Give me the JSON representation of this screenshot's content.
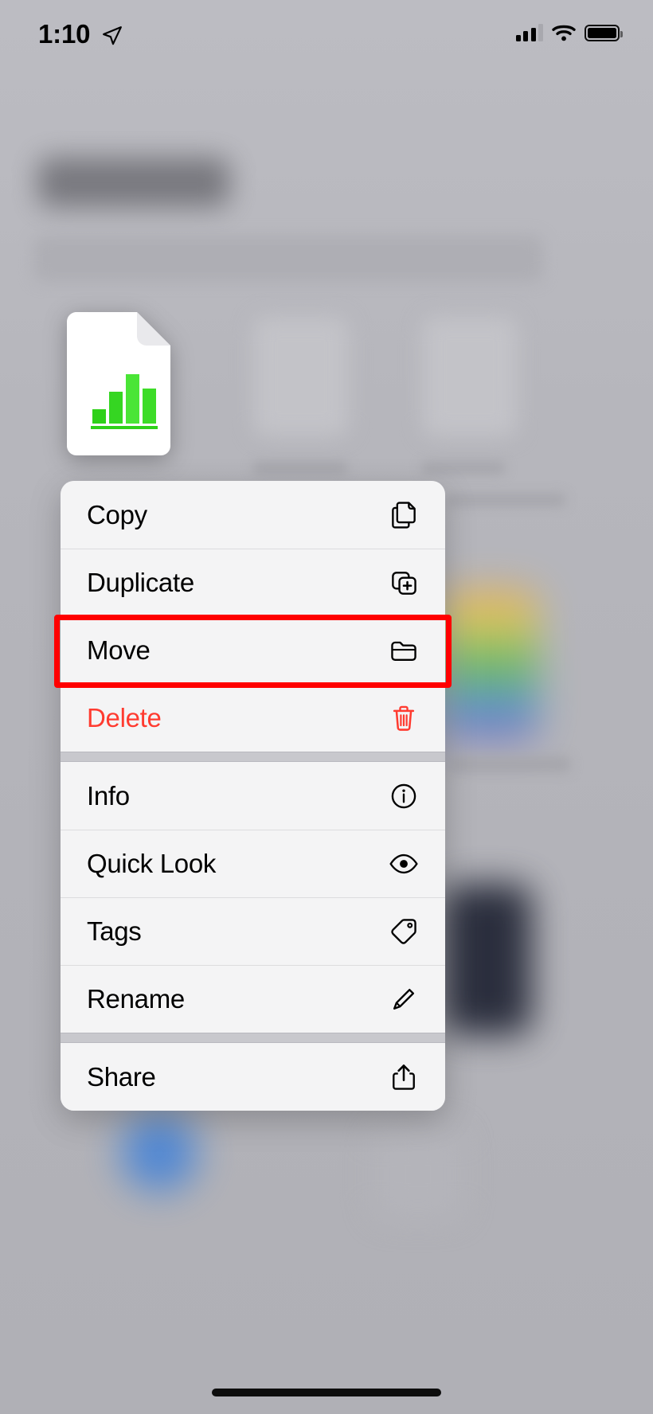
{
  "status_bar": {
    "time": "1:10",
    "location_icon": "location-arrow-icon",
    "cellular_icon": "cellular-signal-icon",
    "wifi_icon": "wifi-icon",
    "battery_icon": "battery-full-icon"
  },
  "background": {
    "note": "blurred Files app browse view behind the context menu",
    "title_placeholder": "",
    "search_placeholder": ""
  },
  "selected_file": {
    "thumbnail_icon": "numbers-spreadsheet-file-icon",
    "accent_color": "#34d42a"
  },
  "context_menu": {
    "groups": [
      {
        "items": [
          {
            "label": "Copy",
            "icon": "copy-documents-icon",
            "destructive": false
          },
          {
            "label": "Duplicate",
            "icon": "duplicate-plus-icon",
            "destructive": false
          },
          {
            "label": "Move",
            "icon": "folder-icon",
            "destructive": false,
            "highlighted": true
          },
          {
            "label": "Delete",
            "icon": "trash-icon",
            "destructive": true
          }
        ]
      },
      {
        "items": [
          {
            "label": "Info",
            "icon": "info-circle-icon",
            "destructive": false
          },
          {
            "label": "Quick Look",
            "icon": "eye-icon",
            "destructive": false
          },
          {
            "label": "Tags",
            "icon": "tag-icon",
            "destructive": false
          },
          {
            "label": "Rename",
            "icon": "pencil-icon",
            "destructive": false
          }
        ]
      },
      {
        "items": [
          {
            "label": "Share",
            "icon": "share-up-arrow-icon",
            "destructive": false
          }
        ]
      }
    ],
    "highlight_color": "#ff0000",
    "destructive_color": "#ff3b30"
  },
  "home_indicator": "home-indicator"
}
